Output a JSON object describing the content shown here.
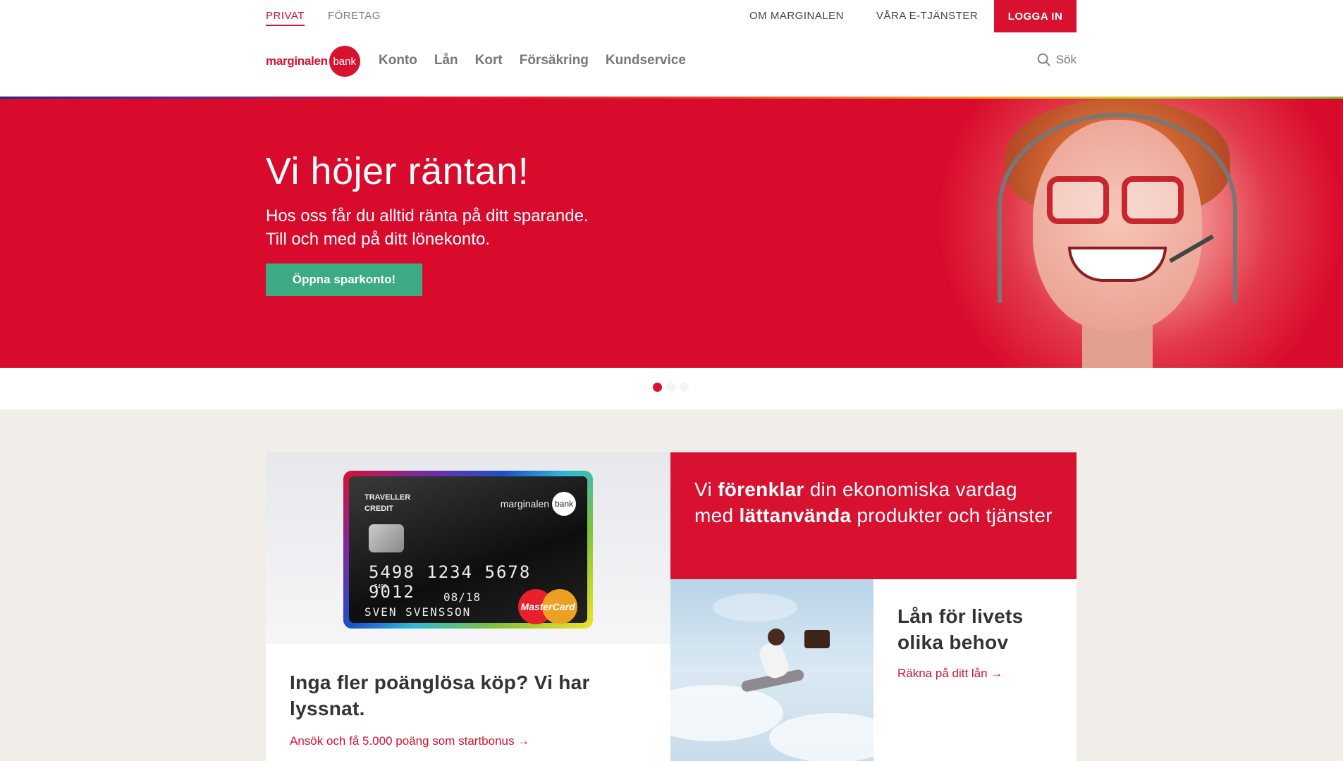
{
  "topbar": {
    "segments": [
      "PRIVAT",
      "FÖRETAG"
    ],
    "links": [
      "OM MARGINALEN",
      "VÅRA E-TJÄNSTER"
    ],
    "login": "LOGGA IN"
  },
  "logo": {
    "word": "marginalen",
    "disc": "bank"
  },
  "nav": {
    "items": [
      "Konto",
      "Lån",
      "Kort",
      "Försäkring",
      "Kundservice"
    ],
    "search": "Sök"
  },
  "hero": {
    "title": "Vi höjer räntan!",
    "line1": "Hos oss får du alltid ränta på ditt sparande.",
    "line2": "Till och med på ditt lönekonto.",
    "cta": "Öppna sparkonto!"
  },
  "carousel": {
    "dots": 3,
    "active": 1
  },
  "card": {
    "type_line1": "TRAVELLER",
    "type_line2": "CREDIT",
    "logo_word": "marginalen",
    "logo_disc": "bank",
    "number": "5498 1234 5678 9012",
    "small": "5498",
    "valid": "08/18",
    "name": "SVEN SVENSSON",
    "brand": "MasterCard"
  },
  "card_section": {
    "title": "Inga fler poänglösa köp? Vi har lyssnat.",
    "link": "Ansök och få 5.000 poäng som startbonus →"
  },
  "promo": {
    "t1": "Vi ",
    "b1": "förenklar",
    "t2": " din ekonomiska vardag med ",
    "b2": "lättanvända",
    "t3": " produkter och tjänster"
  },
  "loan": {
    "title": "Lån för livets olika behov",
    "link": "Räkna på ditt lån →"
  },
  "colors": {
    "brand_red": "#d7112f",
    "cta_green": "#3cab84",
    "page_bg": "#f1eee9"
  }
}
